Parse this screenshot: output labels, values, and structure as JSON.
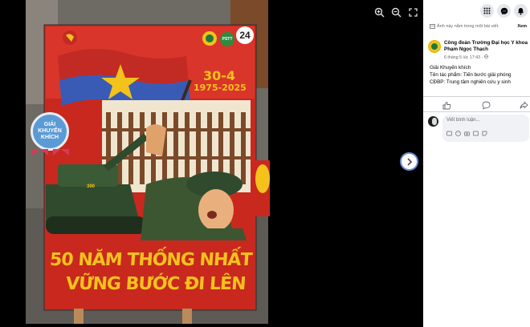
{
  "viewer": {
    "zoom_in_icon": "zoom-in-icon",
    "zoom_out_icon": "zoom-out-icon",
    "fullscreen_icon": "fullscreen-icon",
    "next_icon": "chevron-right-icon"
  },
  "poster": {
    "date": "30-4",
    "years": "1975-2025",
    "badge_number": "24",
    "ribbon_line1": "GIẢI",
    "ribbon_line2": "KHUYẾN",
    "ribbon_line3": "KHÍCH",
    "tank_number": "390",
    "slogan_line1": "50 NĂM THỐNG NHẤT",
    "slogan_line2": "VỮNG BƯỚC ĐI LÊN",
    "logo_text": "PSTT"
  },
  "panel": {
    "top_icons": [
      "grid-menu-icon",
      "messenger-icon",
      "bell-icon"
    ],
    "hidden_notice": "Ảnh này nằm trong một bài viết.",
    "view_link": "Xem",
    "author": "Công đoàn Trường Đại học Y khoa Phạm Ngọc Thạch",
    "timestamp": "6 tháng 5 lúc 17:43 · ",
    "post_lines": [
      "Giải Khuyến khích",
      "Tên tác phẩm: Tiến bước giải phóng",
      "CĐBP: Trung tâm nghiên cứu y sinh"
    ],
    "comment_placeholder": "Viết bình luận...",
    "accent": "#1877f2"
  }
}
